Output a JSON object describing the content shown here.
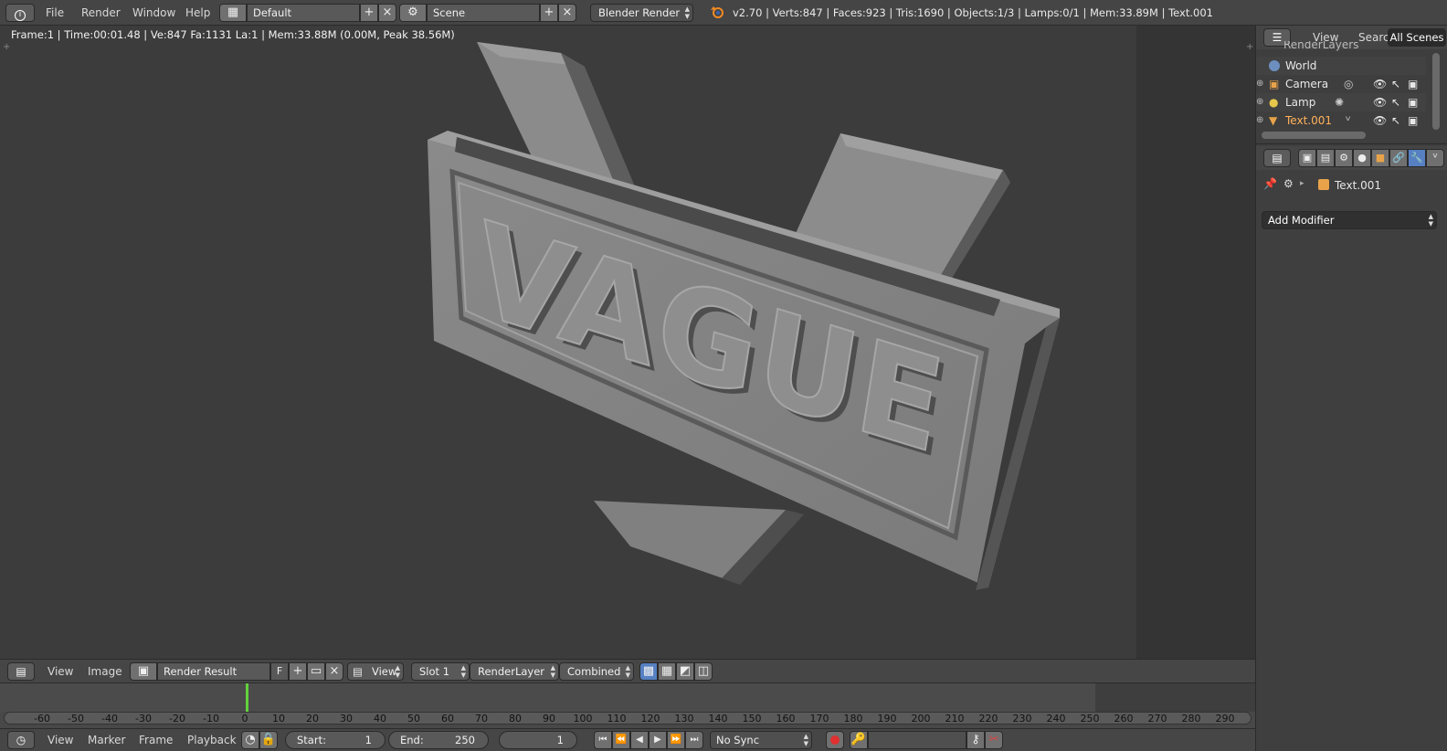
{
  "topbar": {
    "menus": [
      "File",
      "Render",
      "Window",
      "Help"
    ],
    "screen_layout": "Default",
    "scene": "Scene",
    "engine": "Blender Render",
    "stats": "v2.70 | Verts:847 | Faces:923 | Tris:1690 | Objects:1/3 | Lamps:0/1 | Mem:33.89M | Text.001"
  },
  "viewport": {
    "status": "Frame:1 | Time:00:01.48 | Ve:847 Fa:1131 La:1 | Mem:33.88M (0.00M, Peak 38.56M)",
    "render_text": "VAGUE"
  },
  "image_editor": {
    "menus": [
      "View",
      "Image"
    ],
    "image_name": "Render Result",
    "fake_user": "F",
    "view": "View",
    "slot": "Slot 1",
    "layer": "RenderLayer",
    "pass": "Combined"
  },
  "timeline": {
    "ticks": [
      "-60",
      "-50",
      "-40",
      "-30",
      "-20",
      "-10",
      "0",
      "10",
      "20",
      "30",
      "40",
      "50",
      "60",
      "70",
      "80",
      "90",
      "100",
      "110",
      "120",
      "130",
      "140",
      "150",
      "160",
      "170",
      "180",
      "190",
      "200",
      "210",
      "220",
      "230",
      "240",
      "250",
      "260",
      "270",
      "280",
      "290"
    ],
    "current_frame": 1
  },
  "bottom": {
    "menus": [
      "View",
      "Marker",
      "Frame",
      "Playback"
    ],
    "start_label": "Start:",
    "start": "1",
    "end_label": "End:",
    "end": "250",
    "current": "1",
    "sync": "No Sync"
  },
  "outliner": {
    "menus": [
      "View",
      "Search"
    ],
    "filter": "All Scenes",
    "items": [
      {
        "label": "RenderLayers"
      },
      {
        "label": "World"
      },
      {
        "label": "Camera"
      },
      {
        "label": "Lamp"
      },
      {
        "label": "Text.001"
      }
    ]
  },
  "properties": {
    "object_name": "Text.001",
    "add_modifier": "Add Modifier"
  },
  "colors": {
    "accent_blue": "#5680c2",
    "playhead_green": "#62d13d",
    "object_orange": "#e8a34a"
  }
}
